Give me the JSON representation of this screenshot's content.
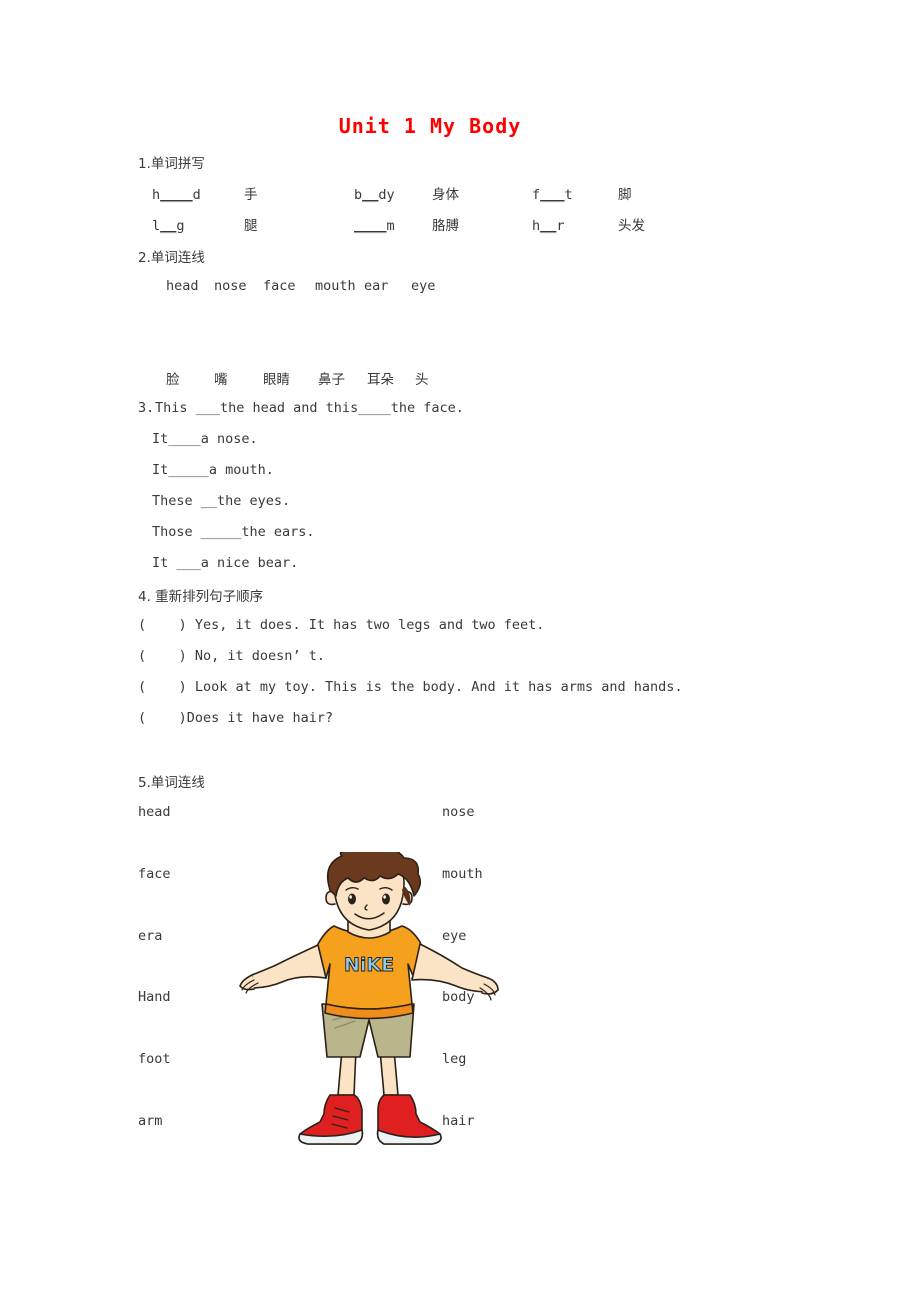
{
  "document": {
    "title": "Unit 1 My Body",
    "title_color": "#ff0000",
    "background_color": "#ffffff",
    "text_color": "#3a3a3a"
  },
  "section1": {
    "heading": "1.单词拼写",
    "rows": [
      [
        {
          "word_prefix": "h",
          "blank": "____",
          "word_suffix": "d",
          "cn": "手"
        },
        {
          "word_prefix": "b",
          "blank": "__",
          "word_suffix": "dy",
          "cn": "身体"
        },
        {
          "word_prefix": "f",
          "blank": "___",
          "word_suffix": "t",
          "cn": "脚"
        }
      ],
      [
        {
          "word_prefix": "l",
          "blank": "__",
          "word_suffix": "g",
          "cn": "腿"
        },
        {
          "word_prefix": "",
          "blank": "____",
          "word_suffix": "m",
          "cn": "胳膊"
        },
        {
          "word_prefix": "h",
          "blank": "__",
          "word_suffix": "r",
          "cn": "头发"
        }
      ]
    ]
  },
  "section2": {
    "heading": "2.单词连线",
    "english_words": [
      "head",
      "nose",
      "face",
      "mouth",
      "ear",
      "eye"
    ],
    "chinese_words": [
      "脸",
      "嘴",
      "眼睛",
      "鼻子",
      "耳朵",
      "头"
    ]
  },
  "section3": {
    "number": "3.",
    "lines": [
      "This ___the head and this____the face.",
      "It____a nose.",
      "It_____a mouth.",
      "These __the eyes.",
      "Those _____the ears.",
      "It ___a nice bear."
    ]
  },
  "section4": {
    "heading": "4. 重新排列句子顺序",
    "items": [
      {
        "marker": "(    ) ",
        "text": "Yes, it does. It has two legs and two feet."
      },
      {
        "marker": "(    ) ",
        "text": "No, it doesn’ t."
      },
      {
        "marker": "(    ) ",
        "text": "Look at my toy. This is the body. And it has arms and hands."
      },
      {
        "marker": "(    )",
        "text": "Does it have hair?"
      }
    ]
  },
  "section5": {
    "heading": "5.单词连线",
    "left_column": [
      "head",
      "face",
      "era",
      "Hand",
      "foot",
      "arm"
    ],
    "right_column": [
      "nose",
      "mouth",
      "eye",
      "body",
      "leg",
      "hair"
    ],
    "illustration": {
      "alt": "cartoon boy standing with arms out",
      "shirt_text": "NiKE",
      "shirt_color": "#f5a11e",
      "shirt_text_color": "#8ecdf0",
      "shorts_color": "#b9b68c",
      "hair_color": "#6b3a1e",
      "skin_color": "#fbe3c6",
      "shoe_color": "#e02020",
      "sole_color": "#ecf3f7"
    }
  }
}
